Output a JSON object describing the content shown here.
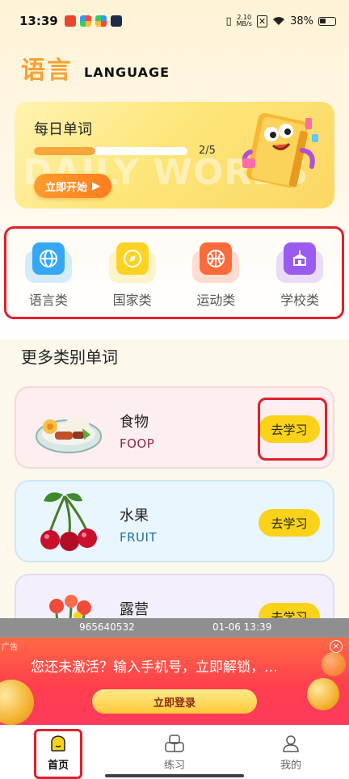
{
  "status_bar": {
    "time": "13:39",
    "network_speed_value": "2.10",
    "network_speed_unit": "MB/s",
    "battery": "38%"
  },
  "header": {
    "title_cn": "语言",
    "title_en": "LANGUAGE"
  },
  "daily_words": {
    "title": "每日单词",
    "progress_text": "2/5",
    "progress_fraction": 0.4,
    "watermark": "DAILY WORDS",
    "start_label": "立即开始"
  },
  "categories": [
    {
      "label": "语言类",
      "icon": "globe-icon",
      "color": "#34a8f5",
      "shadow": "#9fd6fb"
    },
    {
      "label": "国家类",
      "icon": "compass-icon",
      "color": "#fcd322",
      "shadow": "#fde98f"
    },
    {
      "label": "运动类",
      "icon": "basketball-icon",
      "color": "#fa6b3c",
      "shadow": "#fcb49c"
    },
    {
      "label": "学校类",
      "icon": "school-icon",
      "color": "#9a5cf0",
      "shadow": "#cfb1f8"
    }
  ],
  "more_section": {
    "title": "更多类别单词"
  },
  "word_cards": [
    {
      "cn": "食物",
      "en": "FOOP",
      "button": "去学习",
      "bg": "#fdeef0",
      "border": "#f8d6dc",
      "en_color": "#8c2a4a"
    },
    {
      "cn": "水果",
      "en": "FRUIT",
      "button": "去学习",
      "bg": "#e9f6fd",
      "border": "#cbe8f7",
      "en_color": "#1e6ea0"
    },
    {
      "cn": "露营",
      "en": "",
      "button": "去学习",
      "bg": "#f3effd",
      "border": "#e2dbf7",
      "en_color": "#5b3fa0"
    }
  ],
  "watermark_strip": {
    "id": "965640532",
    "timestamp": "01-06 13:39"
  },
  "ad": {
    "tag": "广告",
    "text": "您还未激活？输入手机号，立即解锁，…",
    "button": "立即登录",
    "close": "×"
  },
  "tabbar": [
    {
      "label": "首页",
      "icon": "home-icon",
      "active": true
    },
    {
      "label": "练习",
      "icon": "practice-icon",
      "active": false
    },
    {
      "label": "我的",
      "icon": "profile-icon",
      "active": false
    }
  ]
}
